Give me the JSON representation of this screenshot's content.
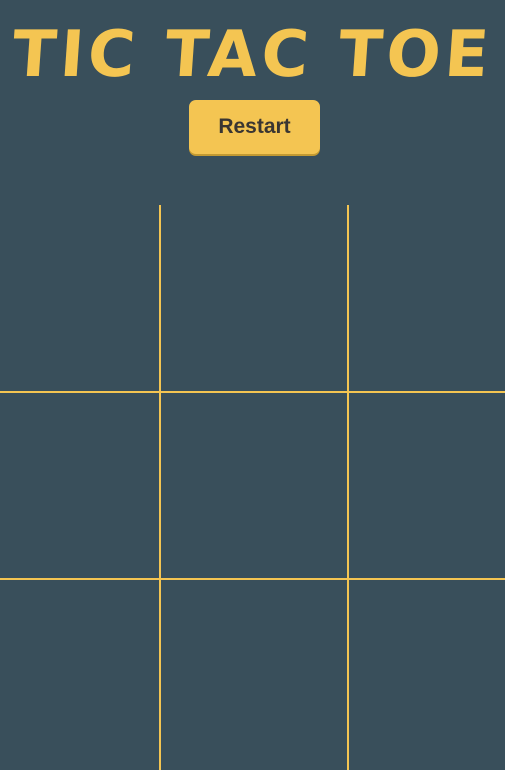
{
  "header": {
    "title": "TIC TAC TOE"
  },
  "controls": {
    "restart_label": "Restart"
  },
  "board": {
    "cells": [
      "",
      "",
      "",
      "",
      "",
      "",
      "",
      "",
      ""
    ]
  },
  "colors": {
    "background": "#394f5b",
    "accent": "#f4c552",
    "button_text": "#3a3632"
  }
}
